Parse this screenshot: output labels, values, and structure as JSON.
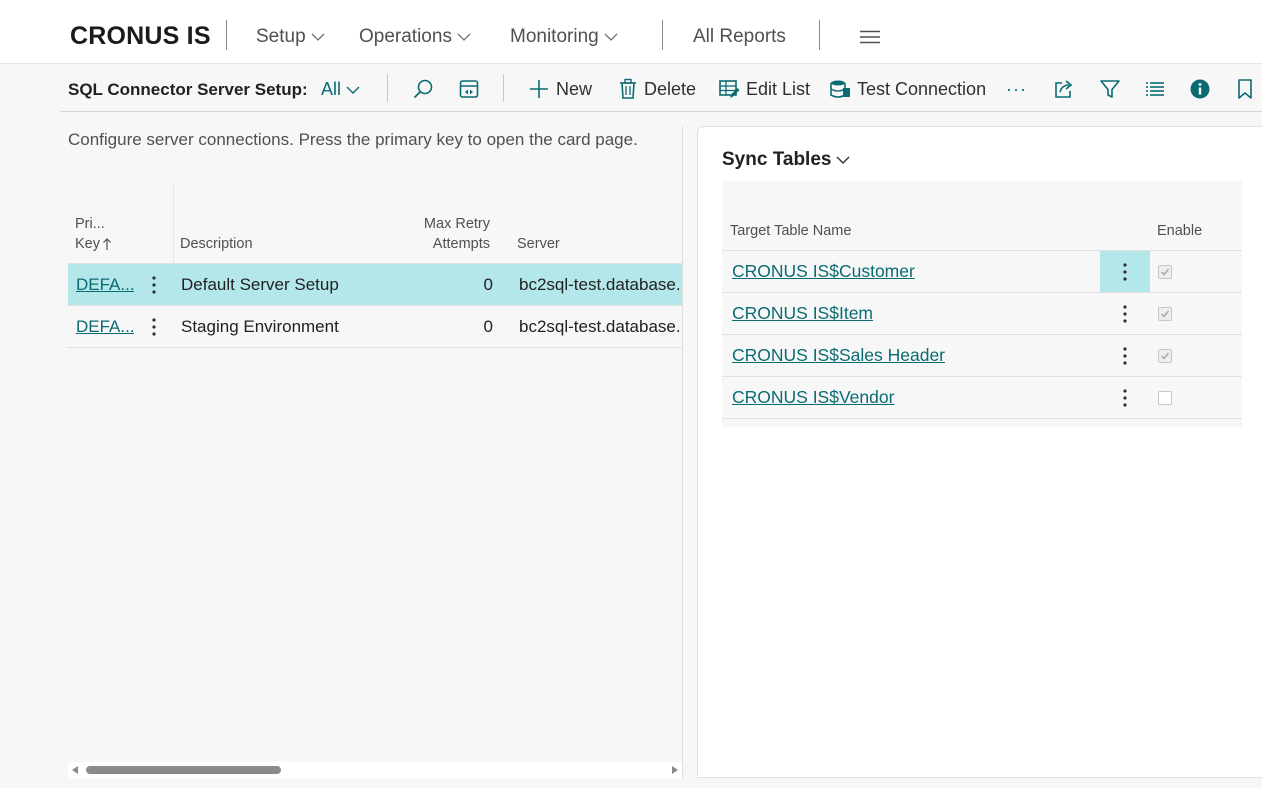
{
  "topnav": {
    "company": "CRONUS IS",
    "items": [
      {
        "label": "Setup"
      },
      {
        "label": "Operations"
      },
      {
        "label": "Monitoring"
      }
    ],
    "all_reports": "All Reports",
    "menu_icon": "hamburger-icon"
  },
  "actionbar": {
    "page_title": "SQL Connector Server Setup:",
    "view_filter": "All",
    "new_label": "New",
    "delete_label": "Delete",
    "edit_list_label": "Edit List",
    "test_connection_label": "Test Connection",
    "more_label": "···",
    "icons": [
      "search-icon",
      "layout-icon",
      "plus-icon",
      "trash-icon",
      "edit-list-icon",
      "test-connection-icon",
      "more-icon",
      "share-icon",
      "filter-icon",
      "list-view-icon",
      "info-icon",
      "bookmark-icon"
    ]
  },
  "list": {
    "description": "Configure server connections. Press the primary key to open the card page.",
    "columns": {
      "primary_key_line1": "Pri...",
      "primary_key_line2": "Key",
      "description": "Description",
      "max_retry_line1": "Max Retry",
      "max_retry_line2": "Attempts",
      "server": "Server"
    },
    "rows": [
      {
        "key": "DEFA...",
        "description": "Default Server Setup",
        "max_retry": "0",
        "server": "bc2sql-test.database.",
        "selected": true
      },
      {
        "key": "DEFA...",
        "description": "Staging Environment",
        "max_retry": "0",
        "server": "bc2sql-test.database.",
        "selected": false
      }
    ]
  },
  "sync_tables": {
    "title": "Sync Tables",
    "columns": {
      "target_table_name": "Target Table Name",
      "enable": "Enable"
    },
    "rows": [
      {
        "name": "CRONUS IS$Customer",
        "enabled": true
      },
      {
        "name": "CRONUS IS$Item",
        "enabled": true
      },
      {
        "name": "CRONUS IS$Sales Header",
        "enabled": true
      },
      {
        "name": "CRONUS IS$Vendor",
        "enabled": false
      }
    ]
  },
  "colors": {
    "accent": "#0a6c72",
    "selected_row": "#b3e7ea",
    "background": "#f7f7f7"
  }
}
